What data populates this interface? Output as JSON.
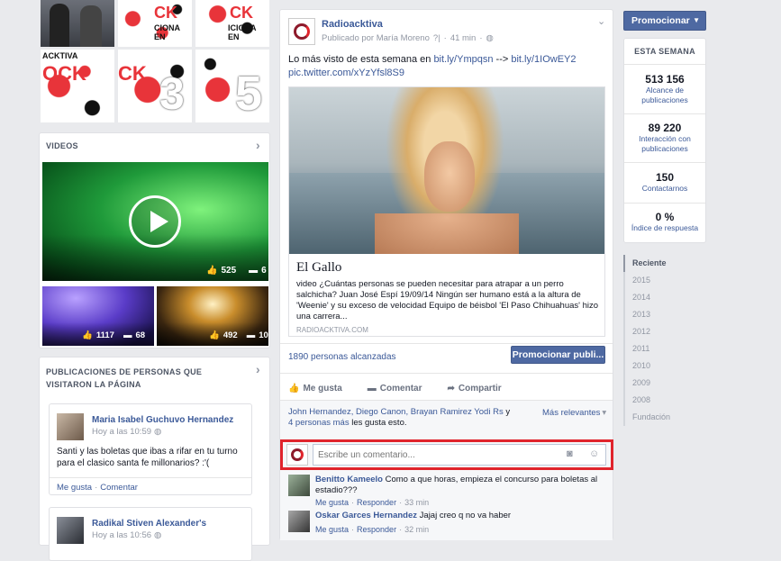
{
  "gallery": {
    "tile_text": [
      "OCK",
      "CIONA EN",
      "ACKTIVA",
      "CK",
      "ICIONA EN",
      "5"
    ]
  },
  "videos": {
    "title": "VIDEOS",
    "main": {
      "likes": "525",
      "comments": "6"
    },
    "thumb1": {
      "likes": "1117",
      "comments": "68"
    },
    "thumb2": {
      "likes": "492",
      "comments": "10"
    }
  },
  "visitors": {
    "title": "PUBLICACIONES DE PERSONAS QUE VISITARON LA PÁGINA",
    "posts": [
      {
        "author": "Maria Isabel Guchuvo Hernandez",
        "time": "Hoy a las 10:59",
        "text": "Santi y las boletas que ibas a rifar en tu turno para el clasico santa fe millonarios? :'(",
        "like": "Me gusta",
        "sep": "·",
        "comment": "Comentar"
      },
      {
        "author": "Radikal Stiven Alexander's",
        "time": "Hoy a las 10:56"
      }
    ]
  },
  "post": {
    "page_name": "Radioacktiva",
    "published_by": "Publicado por María Moreno",
    "byline_mark": "?|",
    "time": "41 min",
    "text_prefix": "Lo más visto de esta semana en ",
    "link1": "bit.ly/Ympqsn",
    "arrow": " --> ",
    "link2": "bit.ly/1IOwEY2",
    "link3": "pic.twitter.com/xYzYfsl8S9",
    "preview": {
      "title": "El Gallo",
      "description": "video ¿Cuántas personas se pueden necesitar para atrapar a un perro salchicha? Juan José Espí 19/09/14 Ningún ser humano está a la altura de 'Weenie' y su exceso de velocidad Equipo de béisbol 'El Paso Chihuahuas' hizo una carrera...",
      "domain": "RADIOACKTIVA.COM"
    },
    "reach": "1890 personas alcanzadas",
    "promote_label": "Promocionar publi...",
    "actions": {
      "like": "Me gusta",
      "comment": "Comentar",
      "share": "Compartir"
    },
    "likers": {
      "names": "John Hernandez, Diego Canon, Brayan Ramirez Yodi Rs",
      "and": " y",
      "more": "4 personas más",
      "suffix": " les gusta esto."
    },
    "sort": "Más relevantes",
    "comment_placeholder": "Escribe un comentario...",
    "comments": [
      {
        "author": "Benitto Kameelo",
        "text": "Como a que horas, empieza el concurso para boletas al estadio???",
        "like": "Me gusta",
        "sep": "·",
        "reply": "Responder",
        "time": "33 min"
      },
      {
        "author": "Oskar Garces Hernandez",
        "text": "Jajaj creo q no va haber",
        "like": "Me gusta",
        "sep": "·",
        "reply": "Responder",
        "time": "32 min"
      }
    ]
  },
  "sidebar": {
    "promote_label": "Promocionar",
    "week_title": "ESTA SEMANA",
    "stats": [
      {
        "num": "513 156",
        "label": "Alcance de publicaciones"
      },
      {
        "num": "89 220",
        "label": "Interacción con publicaciones"
      },
      {
        "num": "150",
        "label": "Contactarnos"
      },
      {
        "num": "0 %",
        "label": "Índice de respuesta"
      }
    ],
    "timeline": [
      "Reciente",
      "2015",
      "2014",
      "2013",
      "2012",
      "2011",
      "2010",
      "2009",
      "2008",
      "Fundación"
    ]
  },
  "colors": {
    "brand": "#3b5998",
    "button": "#4e69a2",
    "highlight_border": "#e0242c",
    "video_green": "#2fb24b"
  }
}
